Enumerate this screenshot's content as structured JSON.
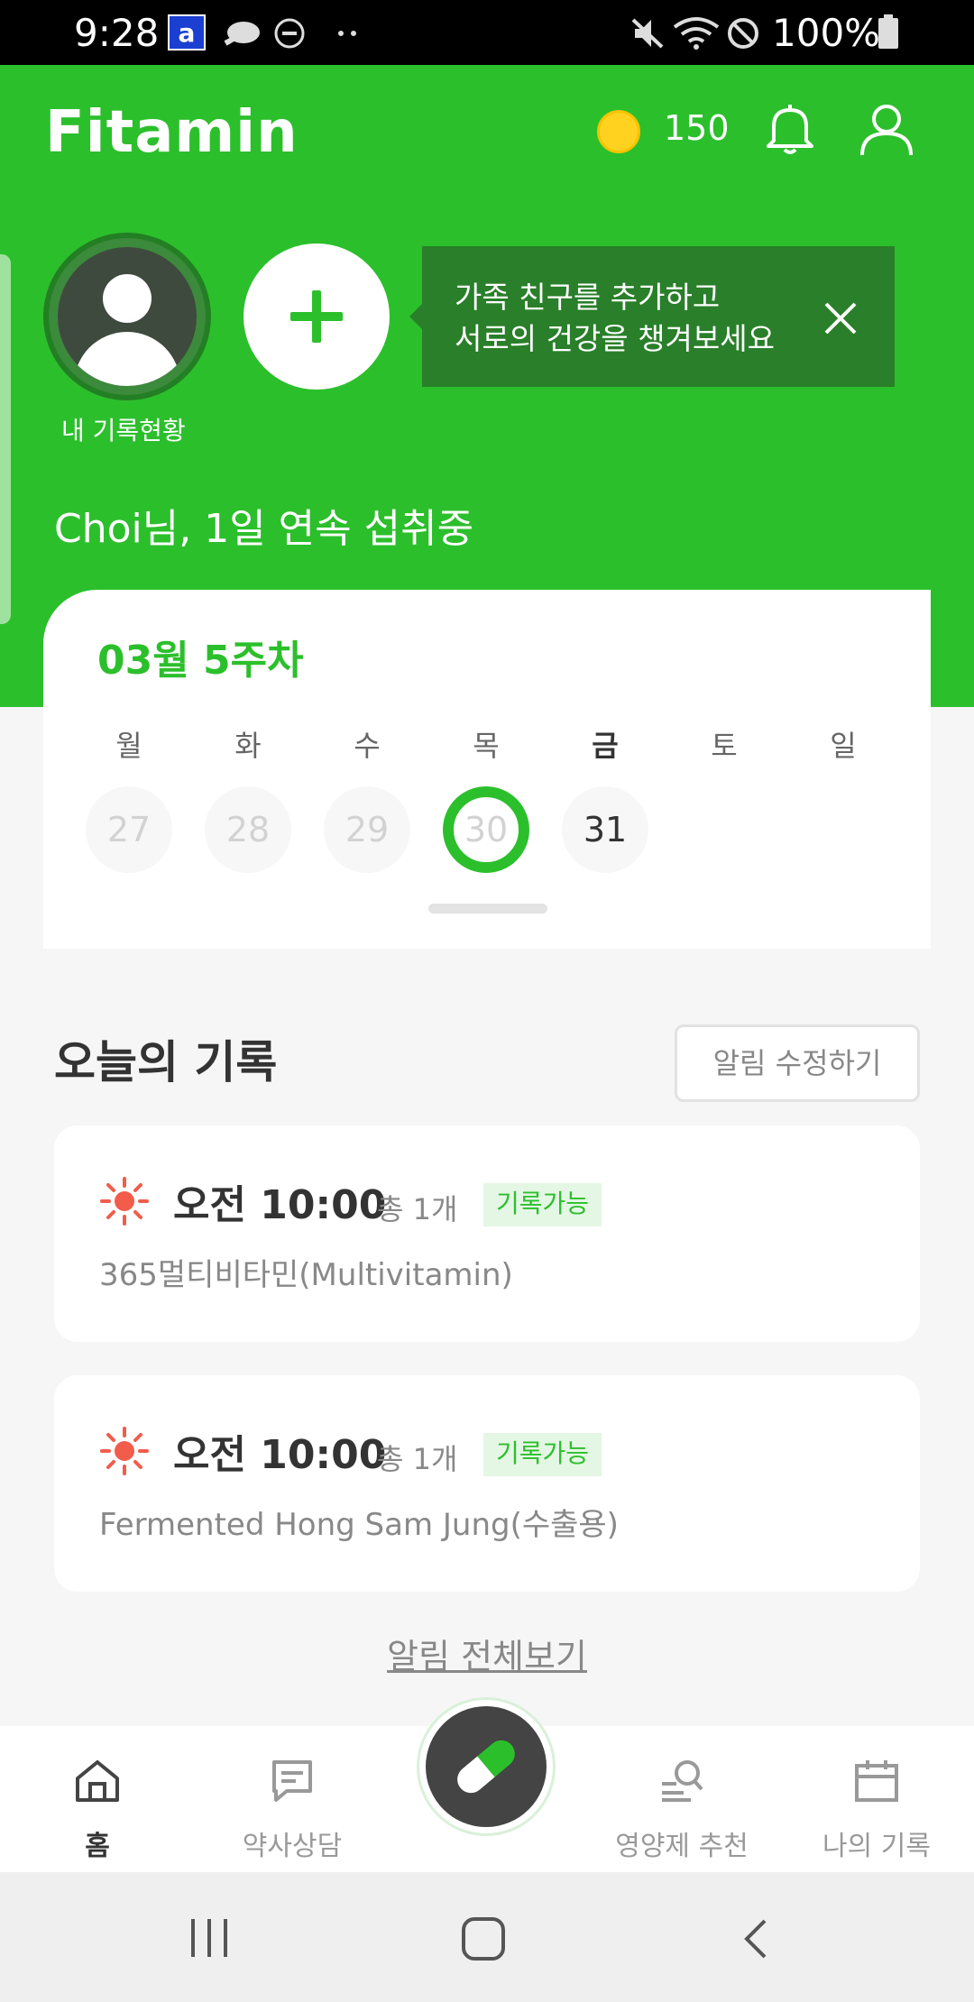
{
  "status_bar": {
    "time": "9:28",
    "app_letter": "a",
    "battery": "100%"
  },
  "header": {
    "logo": "Fitamin",
    "coin_count": "150"
  },
  "family": {
    "my_label": "내 기록현황",
    "tooltip_line1": "가족 친구를 추가하고",
    "tooltip_line2": "서로의 건강을 챙겨보세요"
  },
  "streak_text": "Choi님, 1일 연속 섭취중",
  "week": {
    "title": "03월 5주차",
    "weekdays": [
      "월",
      "화",
      "수",
      "목",
      "금",
      "토",
      "일"
    ],
    "dates": [
      "27",
      "28",
      "29",
      "30",
      "31"
    ],
    "selected_date": "30",
    "today_date": "31"
  },
  "today": {
    "title": "오늘의 기록",
    "edit_button": "알림 수정하기",
    "records": [
      {
        "time": "오전 10:00",
        "count": "총 1개",
        "badge": "기록가능",
        "name": "365멀티비타민(Multivitamin)"
      },
      {
        "time": "오전 10:00",
        "count": "총 1개",
        "badge": "기록가능",
        "name": "Fermented Hong Sam Jung(수출용)"
      }
    ],
    "view_all": "알림 전체보기"
  },
  "bottom_nav": {
    "items": [
      {
        "label": "홈",
        "icon": "home-icon"
      },
      {
        "label": "약사상담",
        "icon": "chat-icon"
      },
      {
        "label": "영양제 추천",
        "icon": "search-person-icon"
      },
      {
        "label": "나의 기록",
        "icon": "calendar-icon"
      }
    ],
    "fab_icon": "pill-icon"
  },
  "colors": {
    "brand_green": "#2cbf2c",
    "dark_green": "#2a7f2a",
    "sun_red": "#f25c4a"
  }
}
